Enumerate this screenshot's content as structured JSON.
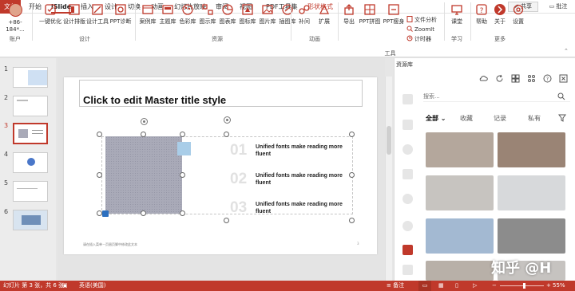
{
  "tabs": {
    "file": "文件",
    "items": [
      "开始",
      "iSlide",
      "插入",
      "设计",
      "切换",
      "动画",
      "幻灯片放映",
      "审阅",
      "视图",
      "PDF工具集",
      "形状格式"
    ],
    "active_index": 1,
    "share": "共享",
    "comment": "批注"
  },
  "ribbon": {
    "account": "+86-184*...",
    "account_group": "账户",
    "design_buttons": [
      "一键优化",
      "设计排版",
      "设计工具",
      "PPT诊断"
    ],
    "design_group": "设计",
    "resource_buttons": [
      "案例库",
      "主题库",
      "色彩库",
      "图示库",
      "图表库",
      "图标库",
      "图片库",
      "插图库"
    ],
    "resource_group": "资源",
    "anim_buttons": [
      "补间",
      "扩展"
    ],
    "anim_group": "动画",
    "tool_buttons": [
      "导出",
      "PPT拼图",
      "PPT瘦身"
    ],
    "tool_small": [
      "文件分析",
      "ZoomIt",
      "计时器"
    ],
    "tool_group": "工具",
    "learn_buttons": [
      "课堂"
    ],
    "learn_group": "学习",
    "more_buttons": [
      "帮助",
      "关于",
      "设置"
    ],
    "more_group": "更多"
  },
  "thumbnails": {
    "numbers": [
      "1",
      "2",
      "3",
      "4",
      "5",
      "6"
    ],
    "selected": "3"
  },
  "slide": {
    "title": "Click to edit Master title style",
    "items": [
      {
        "num": "01",
        "text": "Unified fonts make reading more fluent"
      },
      {
        "num": "02",
        "text": "Unified fonts make reading more fluent"
      },
      {
        "num": "03",
        "text": "Unified fonts make reading more fluent"
      }
    ],
    "footer": "请在插入菜单－页眉页脚中修改此文本",
    "page_number": "3"
  },
  "resource_panel": {
    "title": "资源库",
    "search_placeholder": "搜索...",
    "filters": [
      "全部",
      "收藏",
      "记录",
      "私有"
    ],
    "images": [
      {
        "label": "tea-cups-photo",
        "color": "#b4a79c"
      },
      {
        "label": "old-books-photo",
        "color": "#9a8475"
      },
      {
        "label": "writing-desk-photo",
        "color": "#c7c4c0"
      },
      {
        "label": "paper-stack-photo",
        "color": "#d7d9db"
      },
      {
        "label": "blue-papers-photo",
        "color": "#a3b9d2"
      },
      {
        "label": "open-book-photo",
        "color": "#8c8c8c"
      },
      {
        "label": "books-row-photo",
        "color": "#b8b0a8"
      },
      {
        "label": "paper-photo",
        "color": "#c6c3c0"
      }
    ],
    "watermark": "知乎 @H"
  },
  "statusbar": {
    "slide_info": "幻灯片 第 3 张，共 6 张",
    "language": "英语(美国)",
    "notes": "备注",
    "zoom": "55%",
    "zoom_fraction": 0.55
  },
  "colors": {
    "accent": "#c0392b",
    "placeholder_picture": "#a9aab8",
    "placeholder_square": "#a9cde8"
  }
}
